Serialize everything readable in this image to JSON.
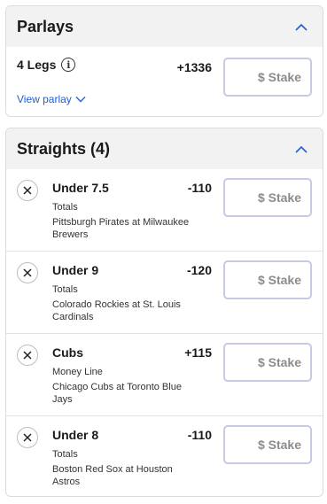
{
  "parlays": {
    "title": "Parlays",
    "legs_label": "4 Legs",
    "odds": "+1336",
    "view_label": "View parlay",
    "stake_placeholder": "$ Stake"
  },
  "straights": {
    "title": "Straights (4)",
    "items": [
      {
        "selection": "Under 7.5",
        "odds": "-110",
        "market": "Totals",
        "event": "Pittsburgh Pirates at Milwaukee Brewers",
        "stake_placeholder": "$ Stake"
      },
      {
        "selection": "Under 9",
        "odds": "-120",
        "market": "Totals",
        "event": "Colorado Rockies at St. Louis Cardinals",
        "stake_placeholder": "$ Stake"
      },
      {
        "selection": "Cubs",
        "odds": "+115",
        "market": "Money Line",
        "event": "Chicago Cubs at Toronto Blue Jays",
        "stake_placeholder": "$ Stake"
      },
      {
        "selection": "Under 8",
        "odds": "-110",
        "market": "Totals",
        "event": "Boston Red Sox at Houston Astros",
        "stake_placeholder": "$ Stake"
      }
    ]
  },
  "colors": {
    "accent": "#1f5fd6",
    "stake_border": "#c6cbe3",
    "header_bg": "#f2f2f2"
  },
  "icons": {
    "collapse": "chevron-up-icon",
    "expand": "chevron-down-icon",
    "info": "info-icon",
    "remove": "close-icon"
  }
}
